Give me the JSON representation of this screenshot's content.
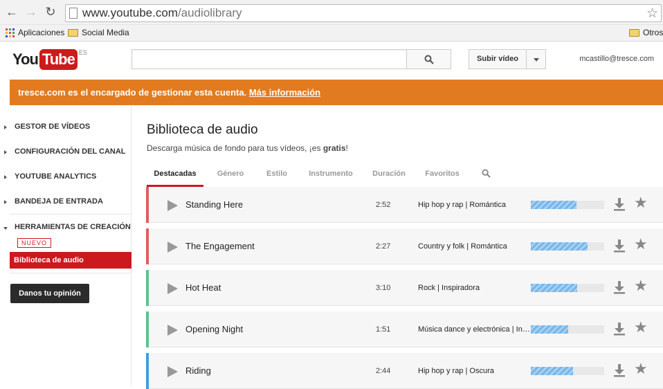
{
  "browser": {
    "url_host": "www.youtube.com",
    "url_path": "/audiolibrary",
    "bookmarks": [
      {
        "label": "Aplicaciones",
        "icon": "apps-grid-icon"
      },
      {
        "label": "Social Media",
        "icon": "folder-icon"
      }
    ],
    "other_bookmarks": "Otros"
  },
  "header": {
    "logo_you": "You",
    "logo_tube": "Tube",
    "logo_region": "ES",
    "search_placeholder": "",
    "upload_label": "Subir vídeo",
    "account": "mcastillo@tresce.com"
  },
  "banner": {
    "text": "tresce.com es el encargado de gestionar esta cuenta.",
    "link": "Más información",
    "color": "#e27b20"
  },
  "sidebar": {
    "items": [
      {
        "label": "GESTOR DE VÍDEOS"
      },
      {
        "label": "CONFIGURACIÓN DEL CANAL"
      },
      {
        "label": "YOUTUBE ANALYTICS"
      },
      {
        "label": "BANDEJA DE ENTRADA"
      },
      {
        "label": "HERRAMIENTAS DE CREACIÓN"
      }
    ],
    "badge": "NUEVO",
    "active_item": "Biblioteca de audio",
    "feedback": "Danos tu opinión"
  },
  "main": {
    "title": "Biblioteca de audio",
    "subtitle_pre": "Descarga música de fondo para tus vídeos, ¡es ",
    "subtitle_bold": "gratis",
    "subtitle_post": "!",
    "tabs": [
      {
        "label": "Destacadas",
        "active": true
      },
      {
        "label": "Género"
      },
      {
        "label": "Estilo"
      },
      {
        "label": "Instrumento"
      },
      {
        "label": "Duración"
      },
      {
        "label": "Favoritos"
      }
    ],
    "tracks": [
      {
        "title": "Standing Here",
        "duration": "2:52",
        "genre": "Hip hop y rap | Romántica",
        "accent": "#e35b62",
        "level": 0.62
      },
      {
        "title": "The Engagement",
        "duration": "2:27",
        "genre": "Country y folk | Romántica",
        "accent": "#e35b62",
        "level": 0.77
      },
      {
        "title": "Hot Heat",
        "duration": "3:10",
        "genre": "Rock | Inspiradora",
        "accent": "#5ec28b",
        "level": 0.63
      },
      {
        "title": "Opening Night",
        "duration": "1:51",
        "genre": "Música dance y electrónica | Inspiradora",
        "accent": "#5ec28b",
        "level": 0.51
      },
      {
        "title": "Riding",
        "duration": "2:44",
        "genre": "Hip hop y rap | Oscura",
        "accent": "#3f9de0",
        "level": 0.58
      }
    ]
  }
}
